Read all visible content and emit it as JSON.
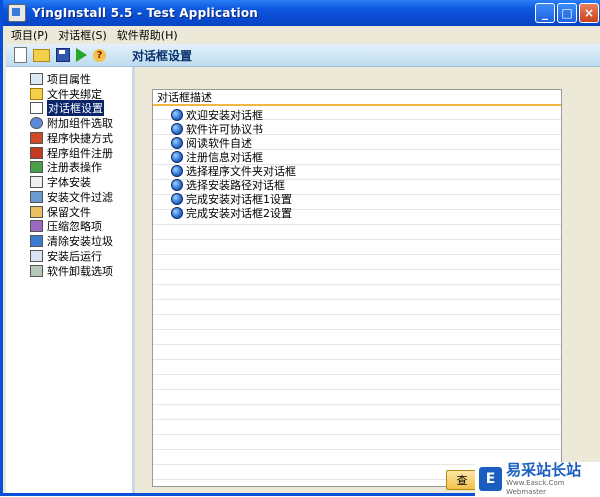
{
  "window": {
    "title": "YingInstall 5.5 - Test Application"
  },
  "caption_buttons": {
    "minimize": "_",
    "maximize": "□",
    "close": "×"
  },
  "menu": {
    "items": [
      "项目(P)",
      "对话框(S)",
      "软件帮助(H)"
    ]
  },
  "toolbar": {
    "icons": [
      "new-file-icon",
      "open-folder-icon",
      "save-icon",
      "run-icon",
      "help-icon"
    ],
    "title": "对话框设置"
  },
  "sidebar": {
    "items": [
      {
        "label": "项目属性",
        "icon": "properties-icon"
      },
      {
        "label": "文件夹绑定",
        "icon": "folder-icon"
      },
      {
        "label": "对话框设置",
        "icon": "dialog-icon",
        "selected": true
      },
      {
        "label": "附加组件选取",
        "icon": "component-icon"
      },
      {
        "label": "程序快捷方式",
        "icon": "shortcut-icon"
      },
      {
        "label": "程序组件注册",
        "icon": "register-icon"
      },
      {
        "label": "注册表操作",
        "icon": "registry-icon"
      },
      {
        "label": "字体安装",
        "icon": "font-icon"
      },
      {
        "label": "安装文件过滤",
        "icon": "filter-icon"
      },
      {
        "label": "保留文件",
        "icon": "keep-file-icon"
      },
      {
        "label": "压缩忽略项",
        "icon": "compress-icon"
      },
      {
        "label": "清除安装垃圾",
        "icon": "clean-icon"
      },
      {
        "label": "安装后运行",
        "icon": "run-after-icon"
      },
      {
        "label": "软件卸载选项",
        "icon": "uninstall-icon"
      }
    ]
  },
  "dialog_list": {
    "header": "对话框描述",
    "items": [
      "欢迎安装对话框",
      "软件许可协议书",
      "阅读软件自述",
      "注册信息对话框",
      "选择程序文件夹对话框",
      "选择安装路径对话框",
      "完成安装对话框1设置",
      "完成安装对话框2设置"
    ]
  },
  "buttons": {
    "search": "查"
  },
  "watermark": {
    "logo": "E",
    "text": "易采站长站",
    "sub": "Www.Easck.Com Webmaster"
  },
  "colors": {
    "titlebar": "#0a4bd1",
    "selection": "#0a246a",
    "header_underline": "#f0b840"
  }
}
